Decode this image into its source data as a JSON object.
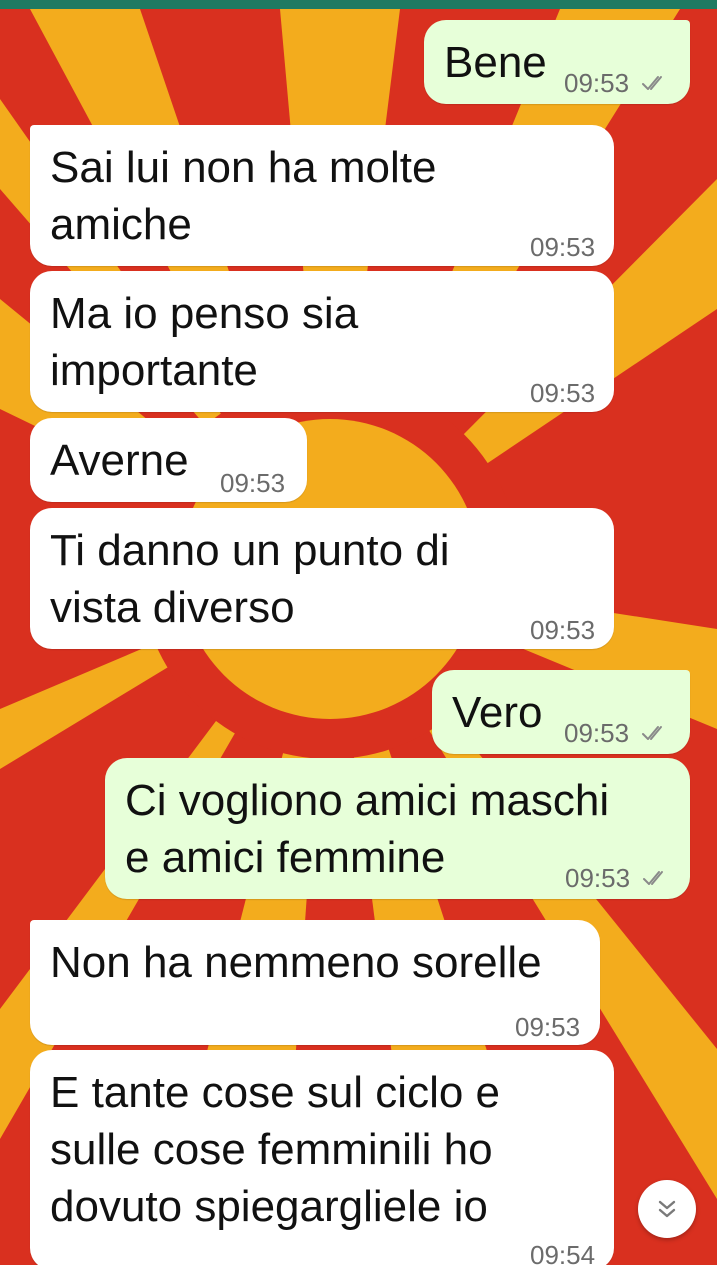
{
  "colors": {
    "incoming_bubble": "#ffffff",
    "outgoing_bubble": "#e7ffd9",
    "wallpaper_red": "#d9301f",
    "wallpaper_yellow": "#f3ac1d"
  },
  "icons": {
    "read_receipt": "double-check-icon",
    "scroll_down": "chevron-double-down-icon"
  },
  "messages": [
    {
      "direction": "outgoing",
      "text": "Bene",
      "time": "09:53",
      "read": true
    },
    {
      "direction": "incoming",
      "text": "Sai lui non ha molte\namiche",
      "time": "09:53"
    },
    {
      "direction": "incoming",
      "text": "Ma io penso sia\nimportante",
      "time": "09:53"
    },
    {
      "direction": "incoming",
      "text": "Averne",
      "time": "09:53"
    },
    {
      "direction": "incoming",
      "text": "Ti danno un punto di\nvista diverso",
      "time": "09:53"
    },
    {
      "direction": "outgoing",
      "text": "Vero",
      "time": "09:53",
      "read": true
    },
    {
      "direction": "outgoing",
      "text": "Ci vogliono amici maschi\ne amici femmine",
      "time": "09:53",
      "read": true
    },
    {
      "direction": "incoming",
      "text": "Non ha nemmeno sorelle",
      "time": "09:53"
    },
    {
      "direction": "incoming",
      "text": "E tante cose sul ciclo e\nsulle cose femminili ho\ndovuto spiegargliele io",
      "time": "09:54"
    }
  ]
}
